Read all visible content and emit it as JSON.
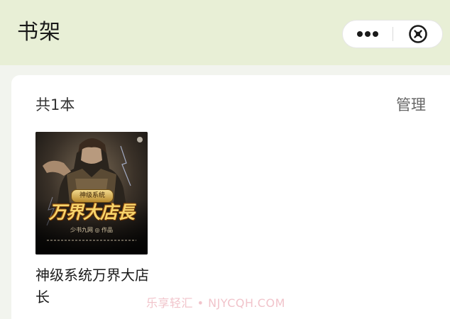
{
  "header": {
    "title": "书架",
    "capsule": {
      "more_icon": "more-dots-icon",
      "close_icon": "circle-close-icon"
    }
  },
  "shelf": {
    "count_label": "共1本",
    "manage_label": "管理",
    "books": [
      {
        "title": "神级系统万界大店长",
        "cover": {
          "badge": "神级系统",
          "title_art": "万界大店長",
          "author_line": "少书九网 ◎ 作品"
        }
      }
    ]
  },
  "watermark": "乐享轻汇 • NJYCQH.COM",
  "colors": {
    "header_bg": "#e8efd6",
    "page_bg": "#f2f4ee",
    "card_bg": "#ffffff",
    "cover_title_gold": "#f7d46b"
  }
}
